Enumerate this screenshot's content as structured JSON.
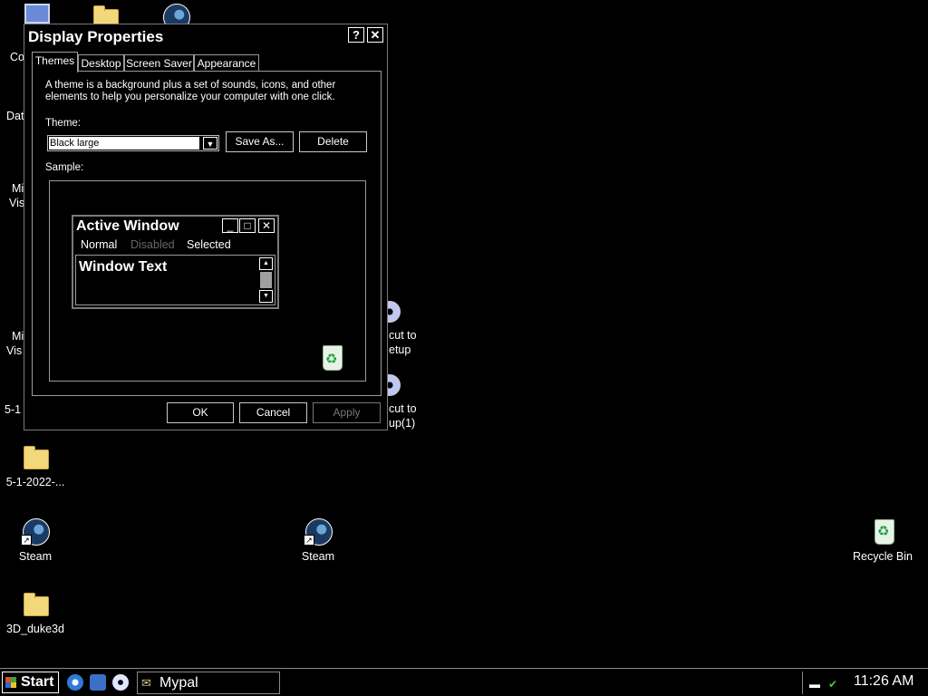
{
  "desktop": {
    "icons": [
      {
        "label": "Co"
      },
      {
        "label": "Dat"
      },
      {
        "label": "Mi"
      },
      {
        "label": "Vis"
      },
      {
        "label": "Mi"
      },
      {
        "label": "Vis"
      },
      {
        "label": "5-1"
      },
      {
        "label": "5-1-2022-..."
      },
      {
        "label": "Steam"
      },
      {
        "label": "Steam"
      },
      {
        "label": "3D_duke3d"
      },
      {
        "label": "Recycle Bin"
      },
      {
        "label": "cut to"
      },
      {
        "label": "etup"
      },
      {
        "label": "cut to"
      },
      {
        "label": "up(1)"
      }
    ]
  },
  "dialog": {
    "title": "Display Properties",
    "help_label": "?",
    "close_label": "✕",
    "tabs": [
      {
        "label": "Themes"
      },
      {
        "label": "Desktop"
      },
      {
        "label": "Screen Saver"
      },
      {
        "label": "Appearance"
      }
    ],
    "description": "A theme is a background plus a set of sounds, icons, and other elements to help you personalize your computer with one click.",
    "theme_label": "Theme:",
    "theme_value": "Black large",
    "save_as_label": "Save As...",
    "delete_label": "Delete",
    "sample_label": "Sample:",
    "sample": {
      "window_title": "Active Window",
      "menu_normal": "Normal",
      "menu_disabled": "Disabled",
      "menu_selected": "Selected",
      "window_text": "Window Text"
    },
    "ok_label": "OK",
    "cancel_label": "Cancel",
    "apply_label": "Apply"
  },
  "taskbar": {
    "start_label": "Start",
    "task_label": "Mypal",
    "clock": "11:26 AM"
  },
  "colors": {
    "background": "#000000",
    "text": "#ffffff",
    "border": "#9a9a9a"
  }
}
